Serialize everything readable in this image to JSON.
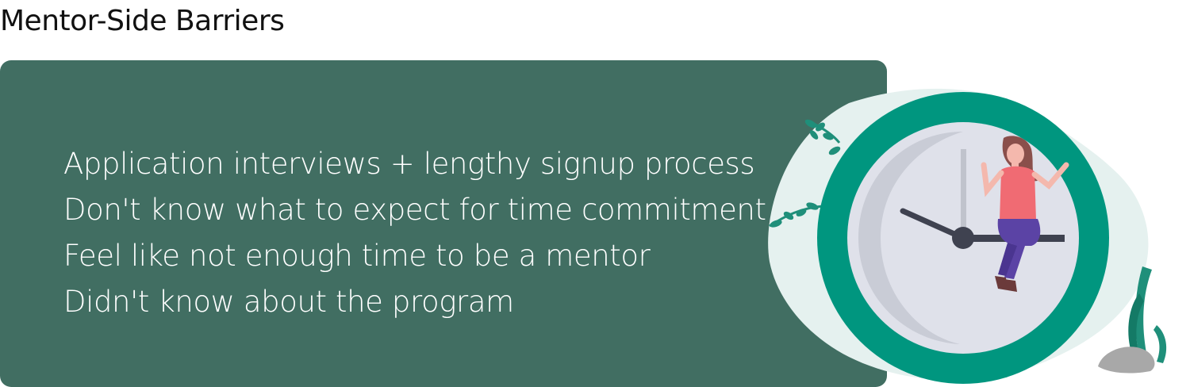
{
  "page": {
    "title": "Mentor-Side Barriers"
  },
  "barriers": [
    "Application interviews + lengthy signup process",
    "Don't know what to expect for time commitment",
    "Feel like not enough time to be a mentor",
    "Didn't know about the program"
  ],
  "illustration": {
    "icon": "clock-with-person-illustration"
  },
  "colors": {
    "panel": "#416e62",
    "clock_ring": "#00967f",
    "clock_face": "#dfe1ea",
    "shirt": "#f06b73",
    "pants": "#5b43a5",
    "hair": "#8a4f4b"
  }
}
